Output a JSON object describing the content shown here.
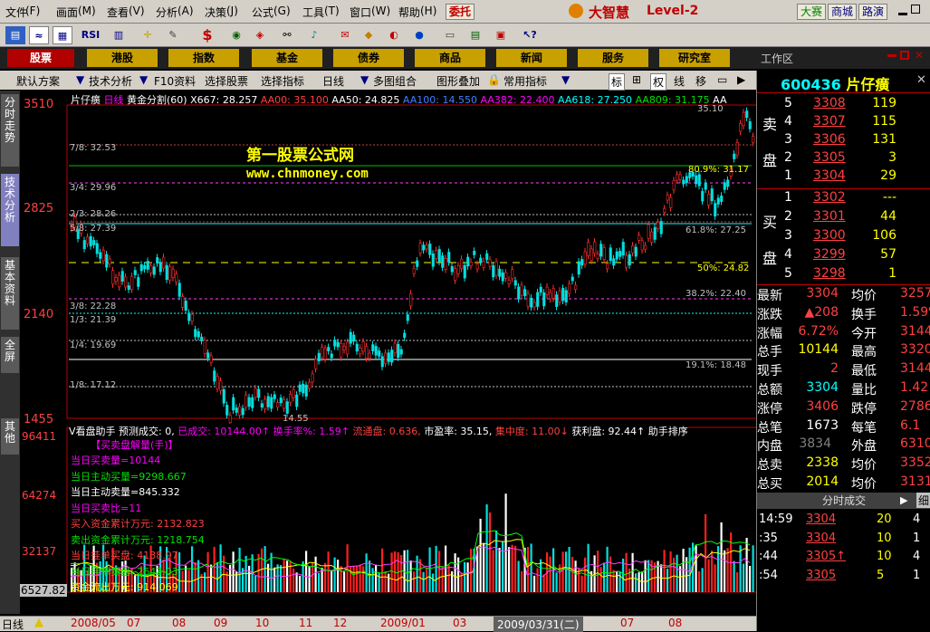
{
  "menubar": {
    "items": [
      "文件",
      "画面",
      "查看",
      "分析",
      "决策",
      "公式",
      "工具",
      "窗口",
      "帮助"
    ],
    "delegate": "委托",
    "brand": "大智慧",
    "level": "Level-2",
    "big_contest": "大赛",
    "mall": "商城",
    "roadshow": "路演"
  },
  "toolbar": {
    "rsi": "RSI",
    "dollar": "$"
  },
  "navbar": {
    "items": [
      "股票",
      "港股",
      "指数",
      "基金",
      "债券",
      "商品",
      "新闻",
      "服务",
      "研究室"
    ],
    "workspace": "工作区"
  },
  "subbar": {
    "items": [
      "默认方案",
      "技术分析",
      "F10资料",
      "选择股票",
      "选择指标",
      "日线",
      "多图组合",
      "图形叠加",
      "常用指标"
    ],
    "btns": [
      "标",
      "权",
      "线",
      "移"
    ]
  },
  "lefttabs": [
    "分时走势",
    "技术分析",
    "基本资料",
    "全屏",
    "其他"
  ],
  "chart": {
    "header_name": "片仔癀",
    "header_period": "日线",
    "header_indicator": "黄金分割(60)",
    "header_x": "X667: 28.257",
    "aa": [
      "AA00: 35.100",
      "AA50: 24.825",
      "AA100: 14.550",
      "AA382: 22.400",
      "AA618: 27.250",
      "AA809: 31.175",
      "AA"
    ],
    "yaxis": [
      "3510",
      "2825",
      "2140",
      "1455"
    ],
    "fib_labels": [
      "7/8: 32.53",
      "3/4: 29.96",
      "2/3: 28.26",
      "5/8: 27.39",
      "3/8: 22.28",
      "1/3: 21.39",
      "1/4: 19.69",
      "1/8: 17.12"
    ],
    "fib_right": [
      "80.9%: 31.17",
      "61.8%: 27.25",
      "50%: 24.82",
      "38.2%: 22.40",
      "19.1%: 18.48"
    ],
    "high_mark": "35.10",
    "low_mark": "14.55",
    "watermark1": "第一股票公式网",
    "watermark2": "www.chnmoney.com",
    "vol_header": [
      "V看盘助手",
      "预测成交: 0,",
      "已成交: 10144.00↑",
      "换手率%: 1.59↑",
      "流通盘: 0.636,",
      "市盈率: 35.15,",
      "集中度: 11.00↓",
      "获利盘: 92.44↑",
      "助手排序"
    ],
    "vol_title": "【买卖盘解量(手)】",
    "vol_items": [
      "当日买卖量=10144",
      "当日主动买量=9298.667",
      "当日主动卖量=845.332",
      "当日买卖比=11",
      "买入资金累计万元: 2132.823",
      "卖出资金累计万元: 1218.754",
      "当日挂单买盘: 4138.97",
      "当日挂单卖盘: 2643.03",
      "资金流出万元: 914.069"
    ],
    "vol_yaxis": [
      "96411",
      "64274",
      "32137",
      "6527.82"
    ],
    "xaxis": [
      "2008/05",
      "07",
      "08",
      "09",
      "10",
      "11",
      "12",
      "2009/01",
      "03",
      "2009/03/31(二)",
      "07",
      "08"
    ]
  },
  "quote": {
    "code": "600436",
    "name": "片仔癀",
    "sell_label": [
      "卖",
      "盘"
    ],
    "buy_label": [
      "买",
      "盘"
    ],
    "sells": [
      [
        "5",
        "3308",
        "119"
      ],
      [
        "4",
        "3307",
        "115"
      ],
      [
        "3",
        "3306",
        "131"
      ],
      [
        "2",
        "3305",
        "3"
      ],
      [
        "1",
        "3304",
        "29"
      ]
    ],
    "buys": [
      [
        "1",
        "3302",
        "---"
      ],
      [
        "2",
        "3301",
        "44"
      ],
      [
        "3",
        "3300",
        "106"
      ],
      [
        "4",
        "3299",
        "57"
      ],
      [
        "5",
        "3298",
        "1"
      ]
    ],
    "stats": [
      [
        "最新",
        "3304",
        "均价",
        "3257"
      ],
      [
        "涨跌",
        "▲208",
        "换手",
        "1.59%"
      ],
      [
        "涨幅",
        "6.72%",
        "今开",
        "3144"
      ],
      [
        "总手",
        "10144",
        "最高",
        "3320"
      ],
      [
        "现手",
        "2",
        "最低",
        "3144"
      ],
      [
        "总额",
        "3304",
        "量比",
        "1.42"
      ],
      [
        "涨停",
        "3406",
        "跌停",
        "2786"
      ],
      [
        "总笔",
        "1673",
        "每笔",
        "6.1"
      ],
      [
        "内盘",
        "3834",
        "外盘",
        "6310"
      ],
      [
        "总卖",
        "2338",
        "均价",
        "3352"
      ],
      [
        "总买",
        "2014",
        "均价",
        "3131"
      ]
    ],
    "ticks_title": "分时成交",
    "ticks_tab": "细",
    "ticks": [
      [
        "14:59",
        "3304",
        "20",
        "4"
      ],
      [
        ":35",
        "3304",
        "10",
        "1"
      ],
      [
        ":44",
        "3305↑",
        "10",
        "4"
      ],
      [
        ":54",
        "3305",
        "5",
        "1"
      ]
    ]
  },
  "bottom": {
    "label": "日线"
  }
}
